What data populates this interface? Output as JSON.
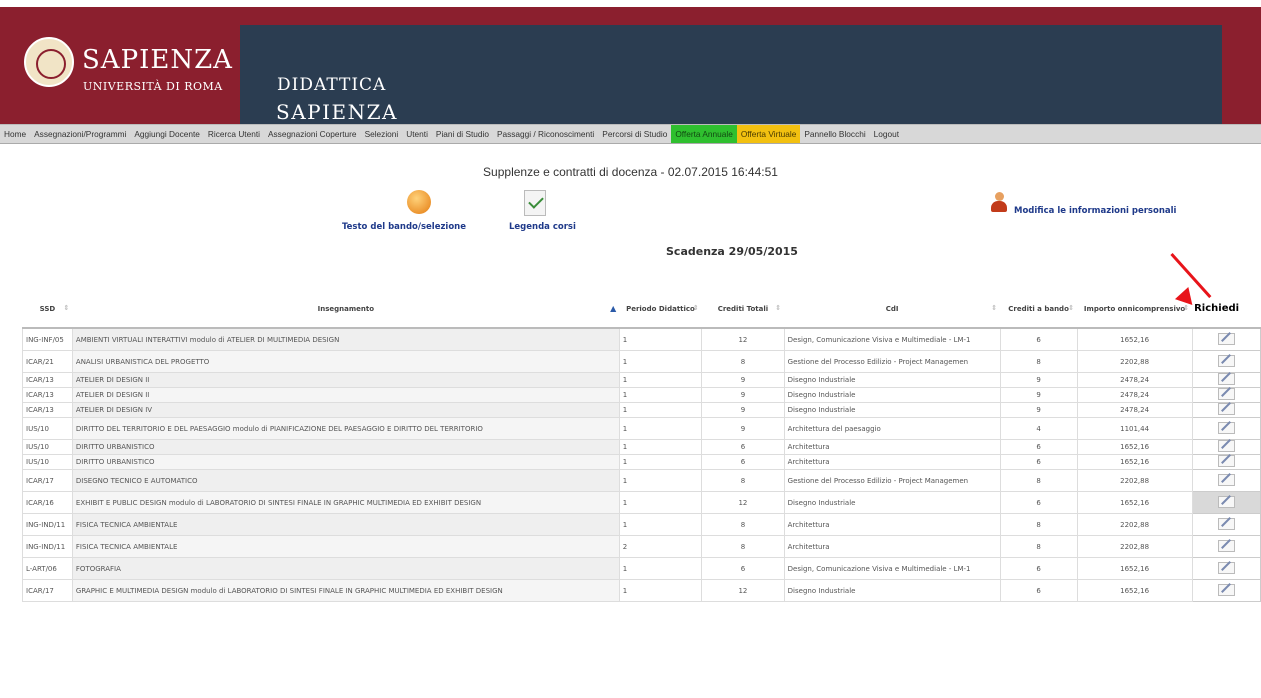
{
  "header": {
    "brand_name": "SAPIENZA",
    "brand_sub": "UNIVERSITÀ DI ROMA",
    "didattica": "DIDATTICA",
    "sapienza": "SAPIENZA"
  },
  "nav": [
    "Home",
    "Assegnazioni/Programmi",
    "Aggiungi Docente",
    "Ricerca Utenti",
    "Assegnazioni Coperture",
    "Selezioni",
    "Utenti",
    "Piani di Studio",
    "Passaggi / Riconoscimenti",
    "Percorsi di Studio",
    "Offerta Annuale",
    "Offerta Virtuale",
    "Pannello Blocchi",
    "Logout"
  ],
  "page": {
    "title": "Supplenze e contratti di docenza - 02.07.2015 16:44:51",
    "bando_link": "Testo del bando/selezione",
    "legenda_link": "Legenda corsi",
    "profile_link": "Modifica le informazioni personali",
    "scadenza": "Scadenza 29/05/2015"
  },
  "colors": {
    "header": "#8b1f2e",
    "panel": "#2b3d51",
    "green": "#2fbf2f",
    "yellow": "#f2c010",
    "arrow": "#e8141a"
  },
  "table": {
    "headers": [
      "SSD",
      "Insegnamento",
      "Periodo Didattico",
      "Crediti Totali",
      "CdI",
      "Crediti a bando",
      "Importo onnicomprensivo",
      "Richiedi"
    ],
    "rows": [
      [
        "ING-INF/05",
        "AMBIENTI VIRTUALI INTERATTIVI modulo di ATELIER DI MULTIMEDIA DESIGN",
        "1",
        "12",
        "Design, Comunicazione Visiva e Multimediale - LM-1",
        "6",
        "1652,16"
      ],
      [
        "ICAR/21",
        "ANALISI URBANISTICA DEL PROGETTO",
        "1",
        "8",
        "Gestione del Processo Edilizio - Project Managemen",
        "8",
        "2202,88"
      ],
      [
        "ICAR/13",
        "ATELIER DI DESIGN II",
        "1",
        "9",
        "Disegno Industriale",
        "9",
        "2478,24"
      ],
      [
        "ICAR/13",
        "ATELIER DI DESIGN II",
        "1",
        "9",
        "Disegno Industriale",
        "9",
        "2478,24"
      ],
      [
        "ICAR/13",
        "ATELIER DI DESIGN IV",
        "1",
        "9",
        "Disegno Industriale",
        "9",
        "2478,24"
      ],
      [
        "IUS/10",
        "DIRITTO DEL TERRITORIO E DEL PAESAGGIO modulo di PIANIFICAZIONE DEL PAESAGGIO E DIRITTO DEL TERRITORIO",
        "1",
        "9",
        "Architettura del paesaggio",
        "4",
        "1101,44"
      ],
      [
        "IUS/10",
        "DIRITTO URBANISTICO",
        "1",
        "6",
        "Architettura",
        "6",
        "1652,16"
      ],
      [
        "IUS/10",
        "DIRITTO URBANISTICO",
        "1",
        "6",
        "Architettura",
        "6",
        "1652,16"
      ],
      [
        "ICAR/17",
        "DISEGNO TECNICO E AUTOMATICO",
        "1",
        "8",
        "Gestione del Processo Edilizio - Project Managemen",
        "8",
        "2202,88"
      ],
      [
        "ICAR/16",
        "EXHIBIT E PUBLIC DESIGN modulo di LABORATORIO DI SINTESI FINALE IN GRAPHIC MULTIMEDIA ED EXHIBIT DESIGN",
        "1",
        "12",
        "Disegno Industriale",
        "6",
        "1652,16"
      ],
      [
        "ING-IND/11",
        "FISICA TECNICA AMBIENTALE",
        "1",
        "8",
        "Architettura",
        "8",
        "2202,88"
      ],
      [
        "ING-IND/11",
        "FISICA TECNICA AMBIENTALE",
        "2",
        "8",
        "Architettura",
        "8",
        "2202,88"
      ],
      [
        "L-ART/06",
        "FOTOGRAFIA",
        "1",
        "6",
        "Design, Comunicazione Visiva e Multimediale - LM-1",
        "6",
        "1652,16"
      ],
      [
        "ICAR/17",
        "GRAPHIC E MULTIMEDIA DESIGN modulo di LABORATORIO DI SINTESI FINALE IN GRAPHIC MULTIMEDIA ED EXHIBIT DESIGN",
        "1",
        "12",
        "Disegno Industriale",
        "6",
        "1652,16"
      ]
    ]
  }
}
